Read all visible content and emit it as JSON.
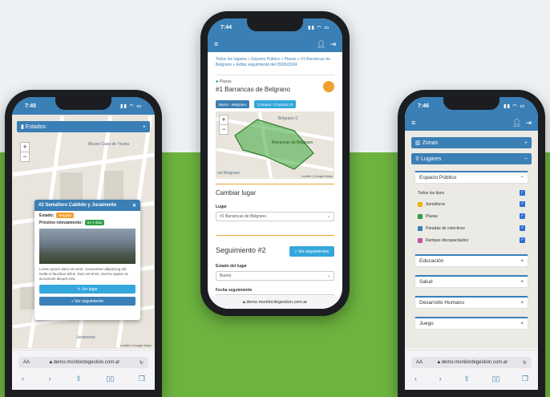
{
  "colors": {
    "primary": "#3a7fb5",
    "accent": "#34a7dc",
    "green": "#6cb33f",
    "warning": "#f0a030",
    "success": "#2f9e44"
  },
  "phone1": {
    "time": "7:45",
    "panel_title": "Estados",
    "map_labels": [
      "Museo Casa de Yrurtia",
      "Juramento"
    ],
    "popup": {
      "title": "#2 Semáforo Cabildo y Juramento",
      "status_label": "Estado:",
      "status_value": "Regular",
      "review_label": "Próximo relevamiento:",
      "review_value": "en 7 días",
      "description": "Lorem ipsum dolor sit amet, consectetur adipiscing elit. Nulla ut faucibus tellus. Duis vel enim, viverra sapien at, accumsan aliquet erat.",
      "btn_view": "Ver lugar",
      "btn_follow": "Ver seguimiento"
    },
    "attribution": "Leaflet | Google Maps",
    "url_prefix": "AA",
    "url": "demo.monitordegestion.com.ar"
  },
  "phone2": {
    "time": "7:44",
    "breadcrumb": "Todos los lugares » Espacio Público » Plazas » #1 Barrancas de Belgrano » Editar seguimiento del 05/06/2024",
    "place_type": "Plazas",
    "place_title": "#1 Barrancas de Belgrano",
    "chips": [
      "Barrio - Belgrano",
      "Comuna - Comuna 13"
    ],
    "map_labels": [
      "Belgrano C",
      "Barrancas de Belgrano",
      "uel Belgrano"
    ],
    "attribution": "Leaflet | Google Maps",
    "change_title": "Cambiar lugar",
    "place_field_label": "Lugar",
    "place_field_value": "#1 Barrancas de Belgrano",
    "follow_title": "Seguimiento #2",
    "follow_button": "Ver seguimientos",
    "state_label": "Estado del lugar",
    "state_value": "Bueno",
    "date_label": "Fecha seguimiento",
    "url": "demo.monitordegestion.com.ar"
  },
  "phone3": {
    "time": "7:46",
    "zonas": "Zonas",
    "lugares": "Lugares",
    "espacio_publico": "Espacio Público",
    "todos": "Todos los tipos",
    "layers": [
      {
        "label": "Semáforos",
        "color": "#e8b400"
      },
      {
        "label": "Plazas",
        "color": "#2f9e44"
      },
      {
        "label": "Paradas de colectivos",
        "color": "#3a7fb5"
      },
      {
        "label": "Rampas discapacitados",
        "color": "#c2509e"
      }
    ],
    "categories": [
      "Educación",
      "Salud",
      "Desarrollo Humano",
      "Juego"
    ],
    "url_prefix": "AA",
    "url": "demo.monitordegestion.com.ar"
  }
}
